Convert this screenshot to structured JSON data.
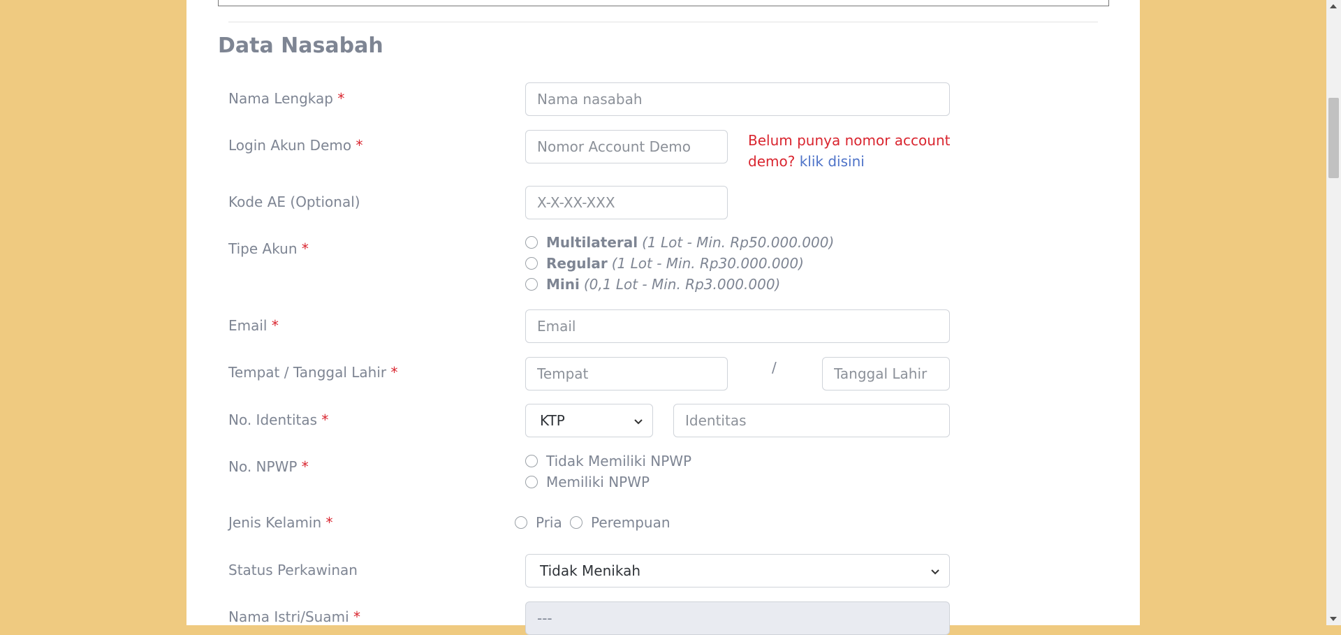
{
  "section": {
    "title": "Data Nasabah"
  },
  "required_mark": "*",
  "fields": {
    "nama": {
      "label": "Nama Lengkap",
      "placeholder": "Nama nasabah"
    },
    "login_demo": {
      "label": "Login Akun Demo",
      "placeholder": "Nomor Account Demo",
      "note": "Belum punya nomor account demo?",
      "note_link": "klik disini"
    },
    "kode_ae": {
      "label": "Kode AE (Optional)",
      "placeholder": "X-X-XX-XXX"
    },
    "tipe_akun": {
      "label": "Tipe Akun",
      "options": [
        {
          "name": "Multilateral",
          "detail": "(1 Lot - Min. Rp50.000.000)"
        },
        {
          "name": "Regular",
          "detail": "(1 Lot - Min. Rp30.000.000)"
        },
        {
          "name": "Mini",
          "detail": "(0,1 Lot - Min. Rp3.000.000)"
        }
      ]
    },
    "email": {
      "label": "Email",
      "placeholder": "Email"
    },
    "ttl": {
      "label": "Tempat / Tanggal Lahir",
      "tempat_placeholder": "Tempat",
      "separator": "/",
      "tanggal_placeholder": "Tanggal Lahir"
    },
    "identitas": {
      "label": "No. Identitas",
      "type_value": "KTP",
      "placeholder": "Identitas"
    },
    "npwp": {
      "label": "No. NPWP",
      "options": [
        "Tidak Memiliki NPWP",
        "Memiliki NPWP"
      ]
    },
    "jenis_kelamin": {
      "label": "Jenis Kelamin",
      "options": [
        "Pria",
        "Perempuan"
      ]
    },
    "status_perkawinan": {
      "label": "Status Perkawinan",
      "value": "Tidak Menikah"
    },
    "pasangan": {
      "label": "Nama Istri/Suami",
      "value": "---"
    }
  },
  "colors": {
    "background": "#efca80",
    "label": "#7e8593",
    "required": "#d9252f",
    "link": "#4e73c8"
  }
}
